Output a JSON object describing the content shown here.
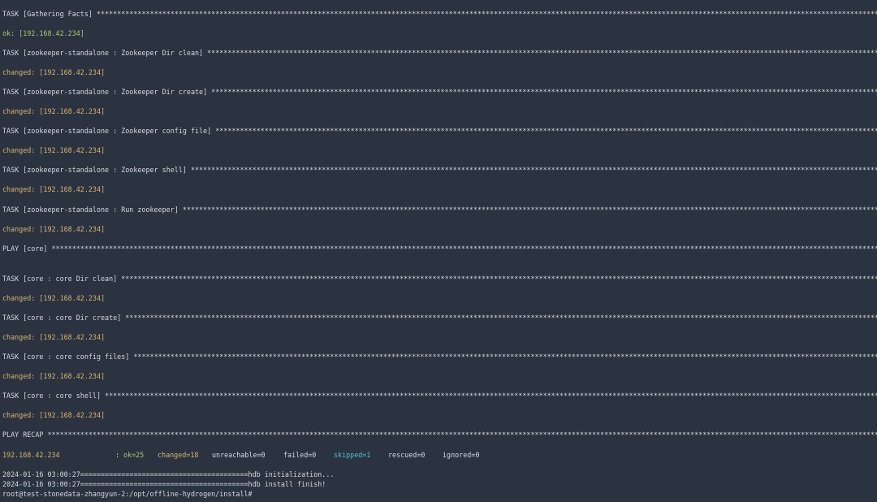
{
  "stars": "************************************************************************************************************************************************************************************************************************************************************************",
  "lines": [
    {
      "task": "TASK [Gathering Facts] "
    },
    {
      "status": "ok: [192.168.42.234]",
      "kind": "ok"
    },
    {
      "task": "TASK [zookeeper-standalone : Zookeeper Dir clean] "
    },
    {
      "status": "changed: [192.168.42.234]",
      "kind": "changed"
    },
    {
      "task": "TASK [zookeeper-standalone : Zookeeper Dir create] "
    },
    {
      "status": "changed: [192.168.42.234]",
      "kind": "changed"
    },
    {
      "task": "TASK [zookeeper-standalone : Zookeeper config file] "
    },
    {
      "status": "changed: [192.168.42.234]",
      "kind": "changed"
    },
    {
      "task": "TASK [zookeeper-standalone : Zookeeper shell] "
    },
    {
      "status": "changed: [192.168.42.234]",
      "kind": "changed"
    },
    {
      "task": "TASK [zookeeper-standalone : Run zookeeper] "
    },
    {
      "status": "changed: [192.168.42.234]",
      "kind": "changed"
    },
    {
      "task": "PLAY [core] "
    },
    {
      "task": "TASK [core : core Dir clean] "
    },
    {
      "status": "changed: [192.168.42.234]",
      "kind": "changed"
    },
    {
      "task": "TASK [core : core Dir create] "
    },
    {
      "status": "changed: [192.168.42.234]",
      "kind": "changed"
    },
    {
      "task": "TASK [core : core config files] "
    },
    {
      "status": "changed: [192.168.42.234]",
      "kind": "changed"
    },
    {
      "task": "TASK [core : core shell] "
    },
    {
      "status": "changed: [192.168.42.234]",
      "kind": "changed"
    },
    {
      "task": "PLAY RECAP "
    }
  ],
  "recap": {
    "host": "192.168.42.234",
    "sep": ": ",
    "ok": "ok=25",
    "changed": "changed=18",
    "unreachable": "unreachable=0",
    "failed": "failed=0",
    "skipped": "skipped=1",
    "rescued": "rescued=0",
    "ignored": "ignored=0"
  },
  "footer": {
    "line1": "2024-01-16 03:00:27=========================================hdb initialization...",
    "line2": "2024-01-16 03:00:27=========================================hdb install finish!",
    "prompt": "root@test-stonedata-zhangyun-2:/opt/offline-hydrogen/install#"
  }
}
